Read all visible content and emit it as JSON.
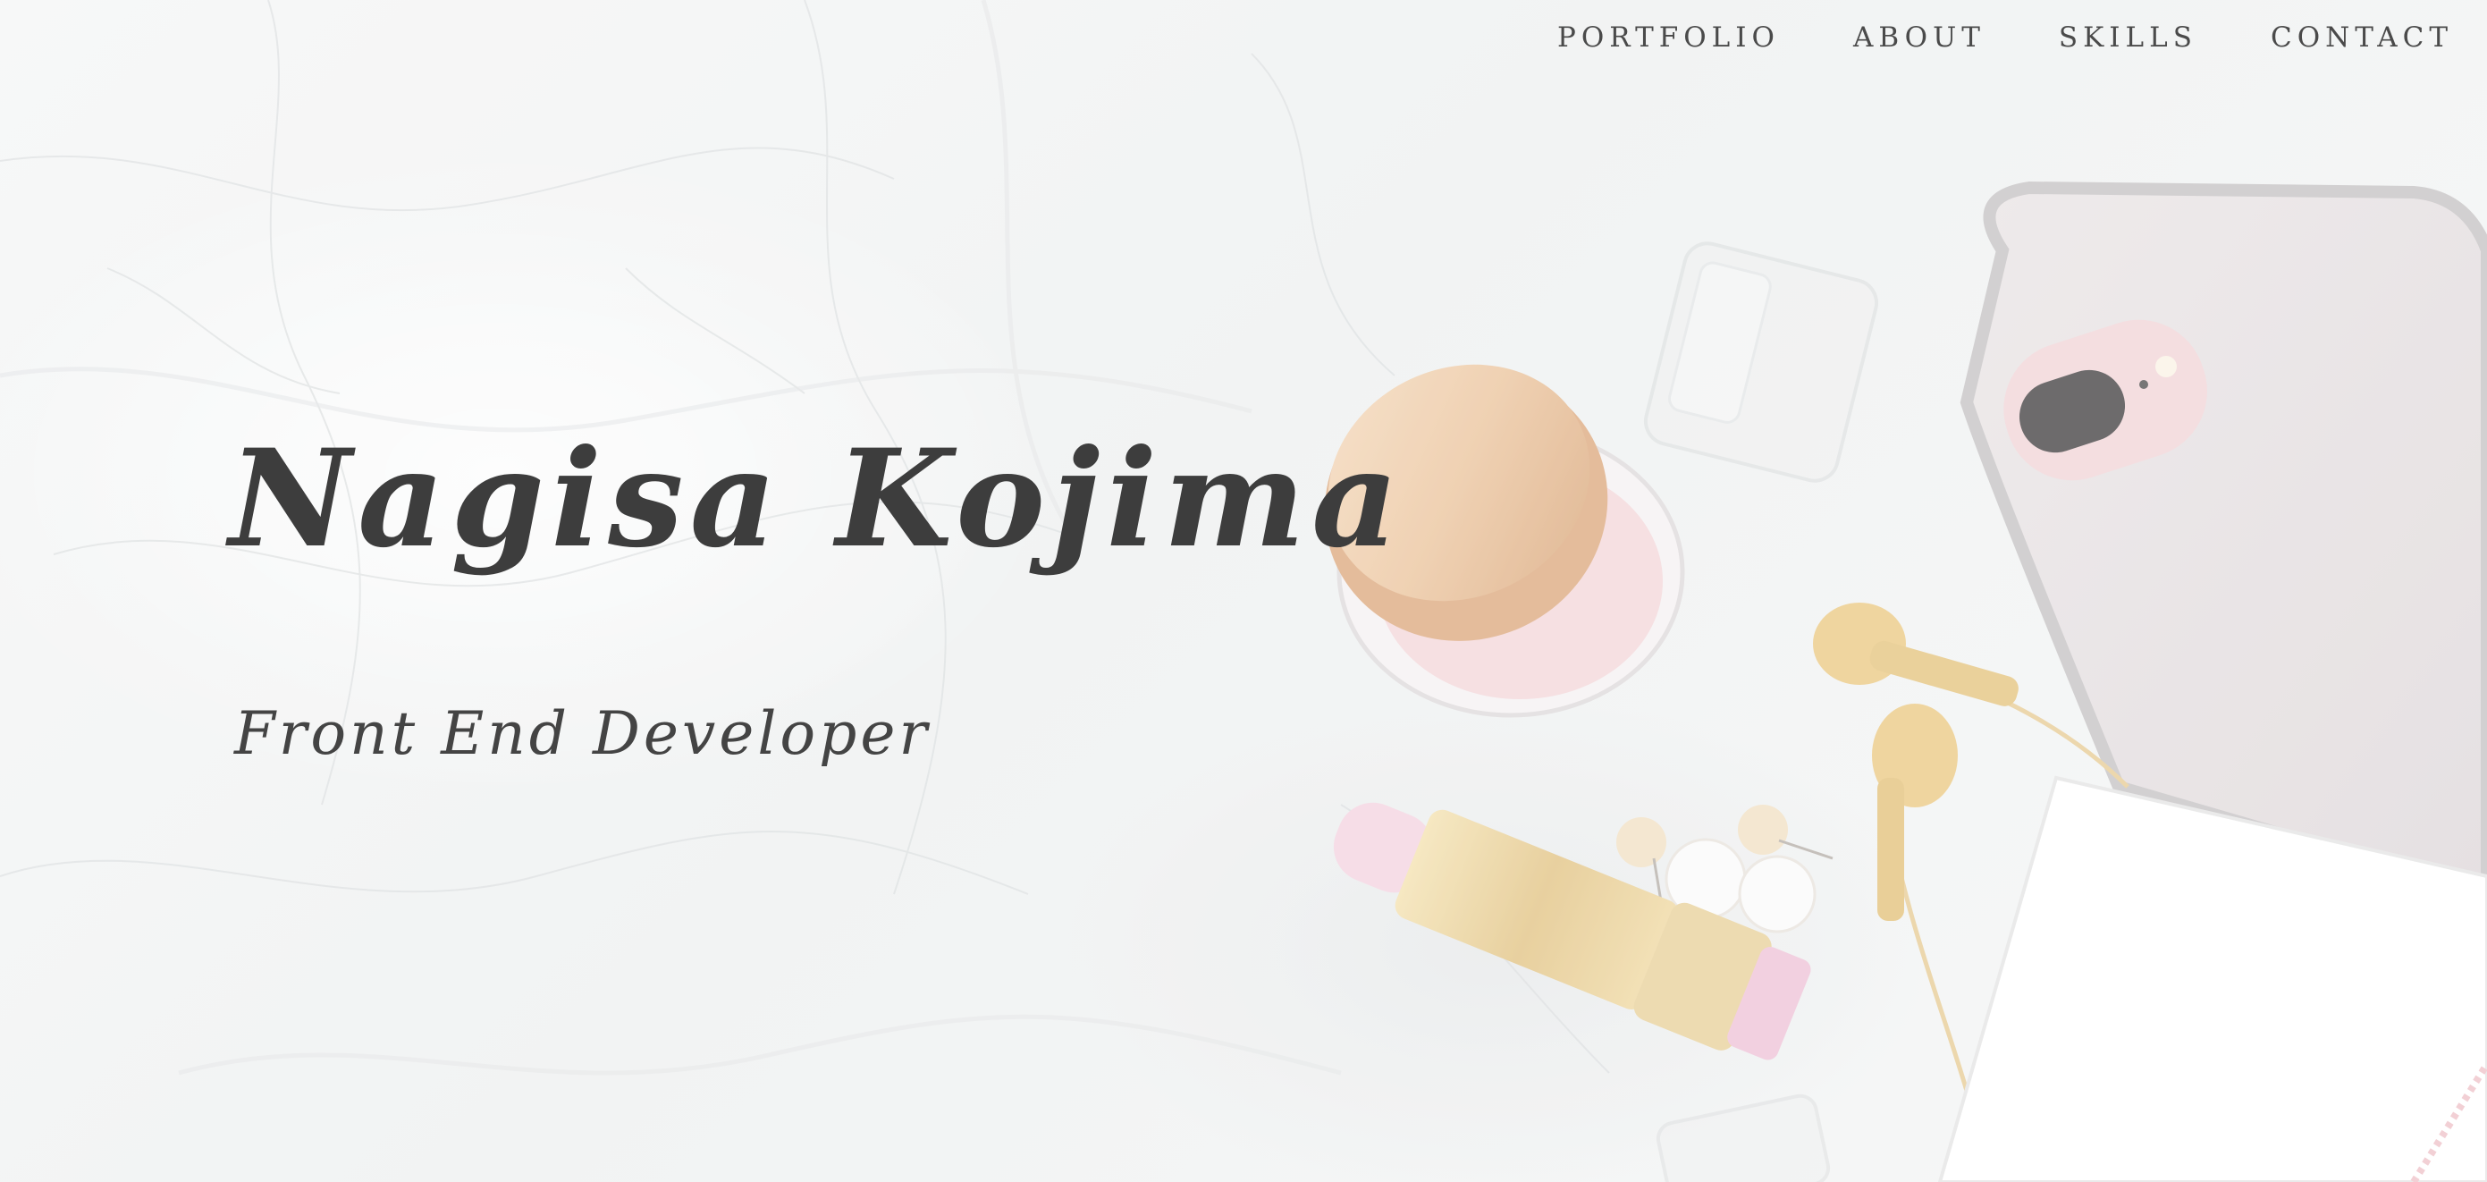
{
  "nav": {
    "items": [
      {
        "label": "PORTFOLIO"
      },
      {
        "label": "ABOUT"
      },
      {
        "label": "SKILLS"
      },
      {
        "label": "CONTACT"
      }
    ]
  },
  "hero": {
    "name": "Nagisa Kojima",
    "title": "Front End Developer"
  },
  "colors": {
    "text_dark": "#3d3d3d",
    "nav_text": "#4a4a4a",
    "background": "#f4f5f5",
    "gold": "#e8c98f",
    "blush": "#f3d3da"
  }
}
